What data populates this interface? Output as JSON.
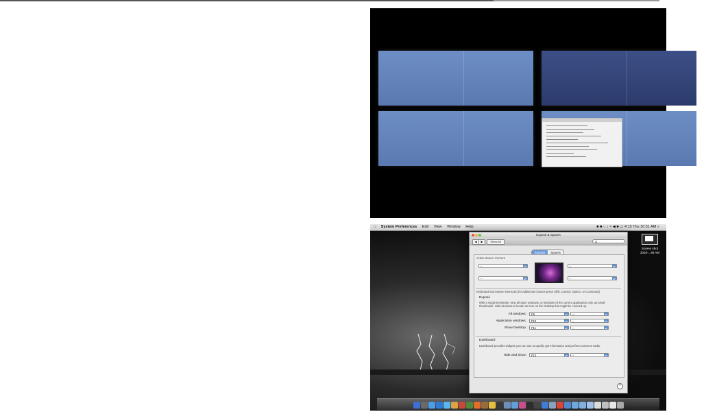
{
  "desktop": {
    "menubar": {
      "apple": "",
      "app_name": "System Preferences",
      "menus": [
        "Edit",
        "View",
        "Window",
        "Help"
      ],
      "status_right": "■ ■ ○ ↕ ≈ ◀ ■ ▭ 4:15 Thu 10:51 AM ⌕"
    },
    "desktop_icon_label": "Screen shot\n2010-...46 AM"
  },
  "window": {
    "title": "Exposé & Spaces",
    "back": "◀",
    "forward": "▶",
    "show_all": "Show All",
    "search_placeholder": "Q",
    "tabs": [
      {
        "label": "Exposé",
        "selected": true
      },
      {
        "label": "Spaces",
        "selected": false
      }
    ],
    "active_corners": {
      "heading": "Active Screen Corners",
      "top_left": "–",
      "top_right": "–",
      "bottom_left": "–",
      "bottom_right": "–"
    },
    "shortcuts_heading": "Keyboard and Mouse Shortcuts (for additional choices press Shift, Control, Option, or Command)",
    "expose": {
      "heading": "Exposé",
      "description": "With a single keystroke, view all open windows, or windows of the current application only, as small thumbnails. Hide windows to locate an item on the desktop that might be covered up.",
      "rows": [
        {
          "label": "All windows:",
          "key": "F9",
          "mouse": "–"
        },
        {
          "label": "Application windows:",
          "key": "F10",
          "mouse": "–"
        },
        {
          "label": "Show Desktop:",
          "key": "F11",
          "mouse": "–"
        }
      ]
    },
    "dashboard": {
      "heading": "Dashboard",
      "description": "Dashboard provides widgets you can use to quickly get information and perform common tasks.",
      "row": {
        "label": "Hide and show:",
        "key": "F12",
        "mouse": "–"
      }
    },
    "help": "?"
  },
  "dock_colors": [
    "#3b6fd1",
    "#6a6a6a",
    "#4a9ee8",
    "#2e7bd6",
    "#5bb6f0",
    "#d9a441",
    "#c8483c",
    "#4d8b3a",
    "#e26d2b",
    "#9b6b3c",
    "#e8c13c",
    "#3a3a3a",
    "#6f8fbf",
    "#5fa0d8",
    "#c94e8e",
    "#2d2d2d",
    "#444444",
    "#3d7ed4",
    "#8aa2c0",
    "#d8463a",
    "#4f87d0",
    "#6fa8dc",
    "#7fb0e0",
    "#9fc3e8",
    "#dcdcdc",
    "#bfbfbf",
    "#e6e6e6",
    "#a8a8a8"
  ]
}
